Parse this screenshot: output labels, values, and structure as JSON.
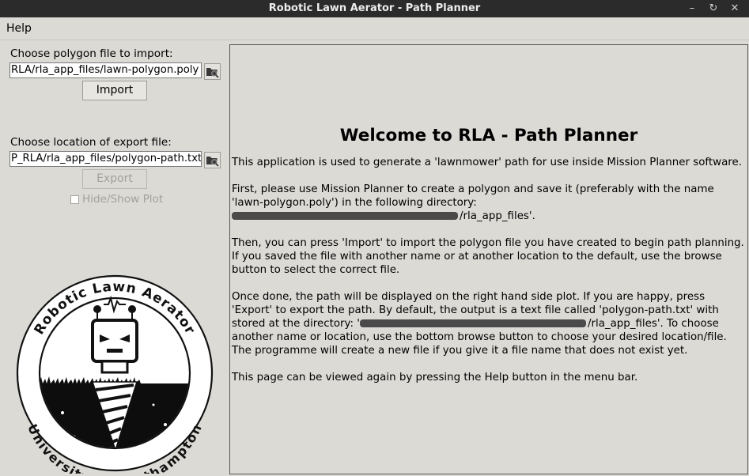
{
  "window": {
    "title": "Robotic Lawn Aerator - Path Planner"
  },
  "menu": {
    "help": "Help"
  },
  "import": {
    "label": "Choose polygon file to import:",
    "path_value": "RLA/rla_app_files/lawn-polygon.poly",
    "button": "Import"
  },
  "export": {
    "label": "Choose location of export file:",
    "path_value": "P_RLA/rla_app_files/polygon-path.txt",
    "button": "Export"
  },
  "plot_toggle": {
    "label": "Hide/Show Plot",
    "checked": false
  },
  "logo": {
    "top_text": "Robotic Lawn Aerator",
    "bottom_text": "University of Southampton"
  },
  "help_page": {
    "title": "Welcome to RLA - Path Planner",
    "p1": "This application is used to generate a 'lawnmower' path for use inside Mission Planner software.",
    "p2_a": "First, please use Mission Planner to create a polygon and save it (preferably with the name 'lawn-polygon.poly') in the following directory:",
    "p2_b": "/rla_app_files'.",
    "p3": "Then, you can press 'Import' to import the polygon file you have created to begin path planning. If you saved the file with another name or at another location to the default, use the browse button to select the correct file.",
    "p4_a": "Once done, the path will be displayed on the right hand side plot. If you are happy, press 'Export' to export the path. By default, the output is a text file called 'polygon-path.txt' with stored at the directory: '",
    "p4_b": "/rla_app_files'. To choose another name or location, use the bottom browse button to choose your desired location/file. The programme will create a new file if you give it a file name that does not exist yet.",
    "p5": "This page can be viewed again by pressing the Help button in the menu bar."
  }
}
